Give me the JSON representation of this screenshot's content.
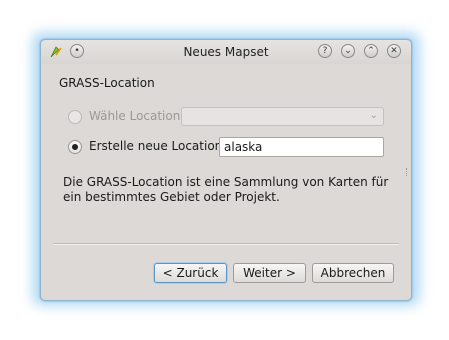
{
  "window": {
    "title": "Neues Mapset",
    "titlebar_buttons": [
      "?",
      "⌄",
      "⌃",
      "✕"
    ]
  },
  "section_label": "GRASS-Location",
  "options": {
    "choose_location": {
      "label": "Wähle Location",
      "enabled": false,
      "selected": false,
      "value": ""
    },
    "create_location": {
      "label": "Erstelle neue Location",
      "enabled": true,
      "selected": true,
      "value": "alaska"
    }
  },
  "description": "Die GRASS-Location ist eine Sammlung von Karten für ein bestimmtes Gebiet oder Projekt.",
  "buttons": {
    "back": "< Zurück",
    "next": "Weiter >",
    "cancel": "Abbrechen"
  },
  "colors": {
    "dialog_bg": "#dcd9d6",
    "focus_accent": "#5a97c9",
    "glow": "#78beeb"
  }
}
